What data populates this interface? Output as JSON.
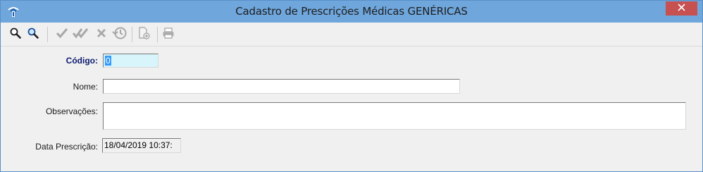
{
  "window": {
    "title": "Cadastro de Prescrições Médicas GENÉRICAS",
    "close_label": "×"
  },
  "toolbar": {
    "items": [
      {
        "name": "search-icon",
        "enabled": true
      },
      {
        "name": "advanced-search-icon",
        "enabled": true
      },
      {
        "name": "confirm-icon",
        "enabled": false
      },
      {
        "name": "confirm-all-icon",
        "enabled": false
      },
      {
        "name": "cancel-icon",
        "enabled": false
      },
      {
        "name": "history-icon",
        "enabled": false
      },
      {
        "name": "new-document-icon",
        "enabled": false
      },
      {
        "name": "print-icon",
        "enabled": false
      }
    ]
  },
  "form": {
    "codigo_label": "Código:",
    "codigo_value": "0",
    "nome_label": "Nome:",
    "nome_value": "",
    "observacoes_label": "Observações:",
    "observacoes_value": "",
    "data_label": "Data Prescrição:",
    "data_value": "18/04/2019 10:37:"
  },
  "colors": {
    "titlebar": "#6fa6dc",
    "close": "#c75050",
    "label_bold": "#0a1a6e",
    "code_field": "#d7f5fb",
    "selection": "#3399ff"
  }
}
